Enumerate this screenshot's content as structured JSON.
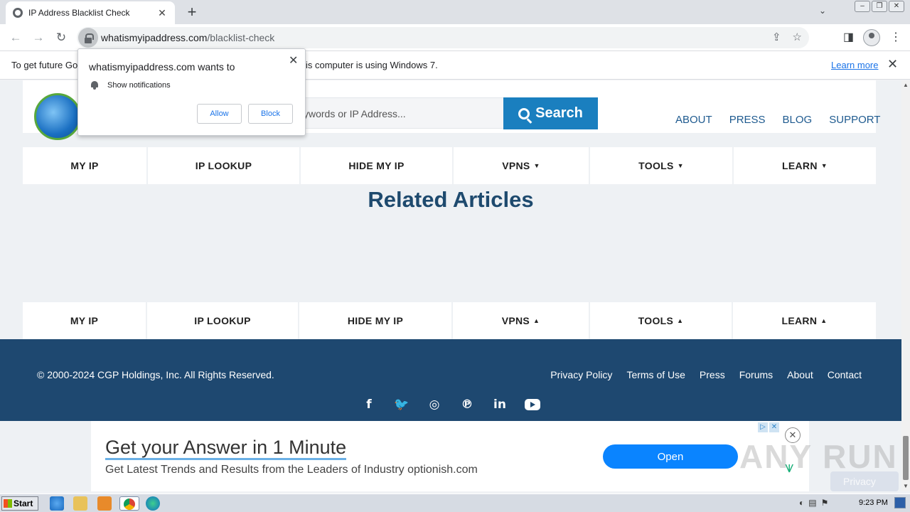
{
  "browser": {
    "tab_title": "IP Address Blacklist Check",
    "tab_close": "✕",
    "new_tab": "+",
    "url_host": "whatismyipaddress.com",
    "url_path": "/blacklist-check"
  },
  "infobar": {
    "message_left": "To get future Go",
    "message_right": "is computer is using Windows 7.",
    "learn_more": "Learn more",
    "close": "✕"
  },
  "notification_popup": {
    "title": "whatismyipaddress.com wants to",
    "permission": "Show notifications",
    "allow": "Allow",
    "block": "Block",
    "close": "✕"
  },
  "header": {
    "search_placeholder": "ywords or IP Address...",
    "search_button": "Search",
    "links": [
      "ABOUT",
      "PRESS",
      "BLOG",
      "SUPPORT"
    ]
  },
  "nav_top": [
    {
      "label": "MY IP",
      "arrow": ""
    },
    {
      "label": "IP LOOKUP",
      "arrow": ""
    },
    {
      "label": "HIDE MY IP",
      "arrow": ""
    },
    {
      "label": "VPNS",
      "arrow": "▼"
    },
    {
      "label": "TOOLS",
      "arrow": "▼"
    },
    {
      "label": "LEARN",
      "arrow": "▼"
    }
  ],
  "related_heading": "Related Articles",
  "nav_bottom": [
    {
      "label": "MY IP",
      "arrow": ""
    },
    {
      "label": "IP LOOKUP",
      "arrow": ""
    },
    {
      "label": "HIDE MY IP",
      "arrow": ""
    },
    {
      "label": "VPNS",
      "arrow": "▲"
    },
    {
      "label": "TOOLS",
      "arrow": "▲"
    },
    {
      "label": "LEARN",
      "arrow": "▲"
    }
  ],
  "footer": {
    "copyright": "© 2000-2024 CGP Holdings, Inc. All Rights Reserved.",
    "links": [
      "Privacy Policy",
      "Terms of Use",
      "Press",
      "Forums",
      "About",
      "Contact"
    ],
    "social": [
      "facebook-icon",
      "twitter-icon",
      "instagram-icon",
      "pinterest-icon",
      "linkedin-icon",
      "youtube-icon"
    ]
  },
  "ad": {
    "title": "Get your Answer in 1 Minute",
    "subtitle": "Get Latest Trends and Results from the Leaders of Industry optionish.com",
    "button": "Open",
    "choice": "▷",
    "x": "✕",
    "close": "✕"
  },
  "watermark": "ANY RUN",
  "privacy": "Privacy",
  "taskbar": {
    "start": "Start",
    "clock": "9:23 PM"
  },
  "colors": {
    "accent": "#1a7fbf",
    "footer_bg": "#1e4870",
    "heading": "#1e4a6e"
  }
}
